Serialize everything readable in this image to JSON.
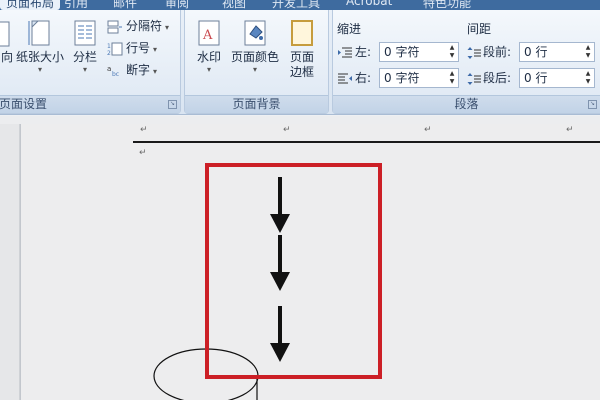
{
  "tabs": [
    "页面布局",
    "引用",
    "邮件",
    "审阅",
    "视图",
    "开发工具",
    "Acrobat",
    "特色功能"
  ],
  "page_setup": {
    "label": "页面设置",
    "direction_partial": "向",
    "paper_size": "纸张大小",
    "columns": "分栏",
    "breaks": "分隔符",
    "line_numbers": "行号",
    "hyphenation": "断字"
  },
  "page_background": {
    "label": "页面背景",
    "watermark": "水印",
    "page_color": "页面颜色",
    "page_border_line1": "页面",
    "page_border_line2": "边框"
  },
  "paragraph": {
    "label": "段落",
    "indent_title": "缩进",
    "spacing_title": "间距",
    "left_label": "左:",
    "left_value": "0 字符",
    "right_label": "右:",
    "right_value": "0 字符",
    "before_label": "段前:",
    "before_value": "0 行",
    "after_label": "段后:",
    "after_value": "0 行"
  },
  "colors": {
    "highlight_box": "#cc1f26",
    "arrow": "#111111",
    "ribbon_tab_bar": "#3e6b9f"
  },
  "paragraph_mark": "↵"
}
